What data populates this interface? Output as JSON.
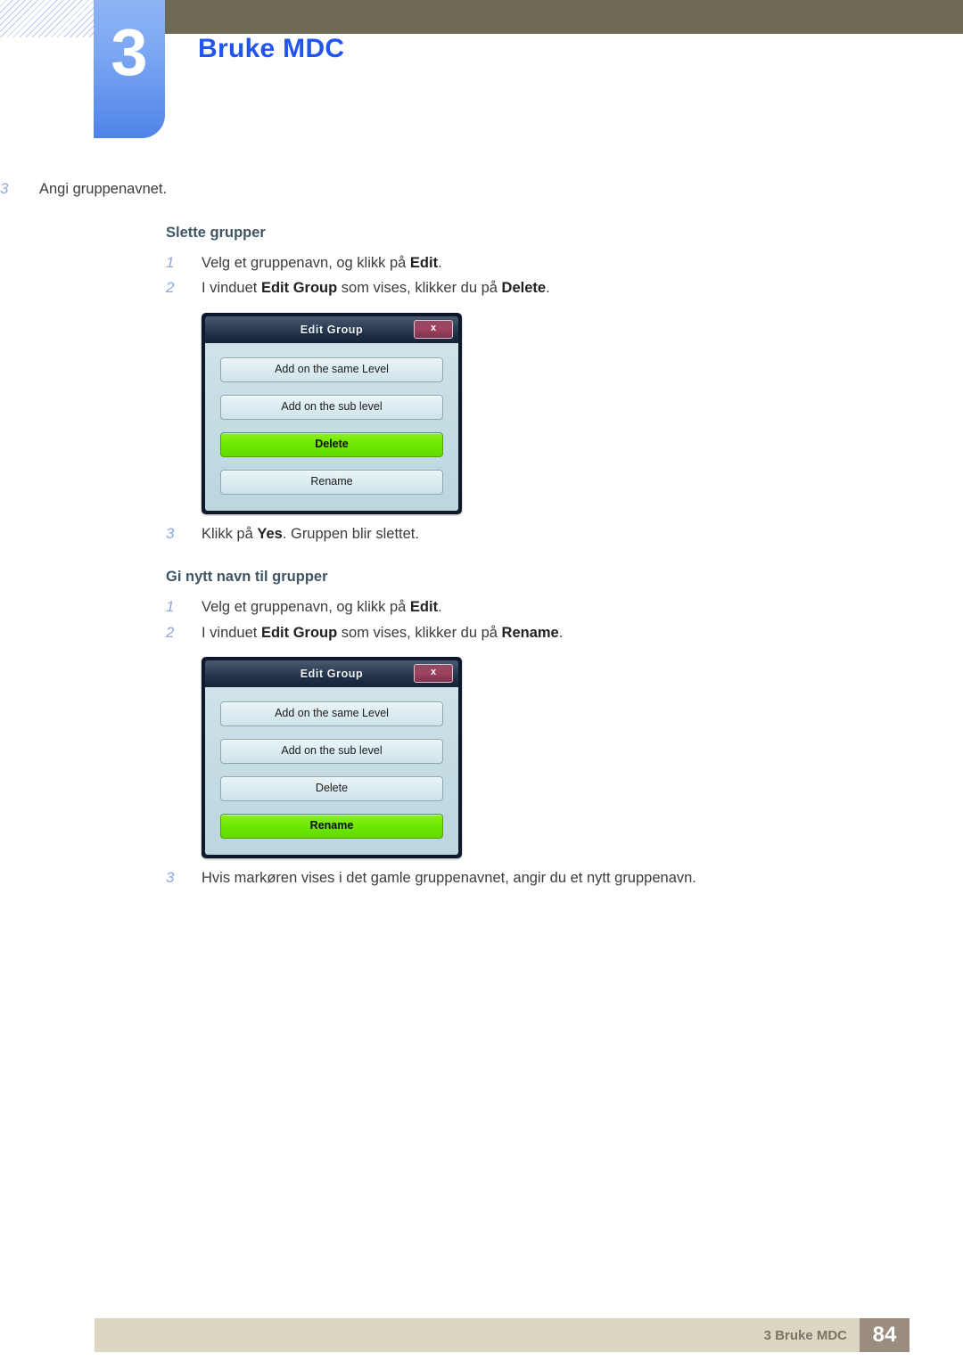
{
  "header": {
    "chapter_number": "3",
    "chapter_title": "Bruke MDC",
    "bar_color": "#6e6a53",
    "badge_color": "#7aa6f2",
    "title_color": "#2255ee"
  },
  "content": {
    "intro_step": {
      "num": "3",
      "text": "Angi gruppenavnet."
    },
    "sections": [
      {
        "heading": "Slette grupper",
        "steps": [
          {
            "num": "1",
            "parts": [
              {
                "t": "Velg et gruppenavn, og klikk på ",
                "b": false
              },
              {
                "t": "Edit",
                "b": true
              },
              {
                "t": ".",
                "b": false
              }
            ]
          },
          {
            "num": "2",
            "parts": [
              {
                "t": "I vinduet ",
                "b": false
              },
              {
                "t": "Edit Group",
                "b": true
              },
              {
                "t": " som vises, klikker du på ",
                "b": false
              },
              {
                "t": "Delete",
                "b": true
              },
              {
                "t": ".",
                "b": false
              }
            ]
          }
        ],
        "final_step": {
          "num": "3",
          "parts": [
            {
              "t": "Klikk på ",
              "b": false
            },
            {
              "t": "Yes",
              "b": true
            },
            {
              "t": ". Gruppen blir slettet.",
              "b": false
            }
          ]
        }
      },
      {
        "heading": "Gi nytt navn til grupper",
        "steps": [
          {
            "num": "1",
            "parts": [
              {
                "t": "Velg et gruppenavn, og klikk på ",
                "b": false
              },
              {
                "t": "Edit",
                "b": true
              },
              {
                "t": ".",
                "b": false
              }
            ]
          },
          {
            "num": "2",
            "parts": [
              {
                "t": "I vinduet ",
                "b": false
              },
              {
                "t": "Edit Group",
                "b": true
              },
              {
                "t": " som vises, klikker du på ",
                "b": false
              },
              {
                "t": "Rename",
                "b": true
              },
              {
                "t": ".",
                "b": false
              }
            ]
          }
        ],
        "final_step": {
          "num": "3",
          "parts": [
            {
              "t": "Hvis markøren vises i det gamle gruppenavnet, angir du et nytt gruppenavn.",
              "b": false
            }
          ]
        }
      }
    ]
  },
  "dialogs": [
    {
      "title": "Edit Group",
      "close_label": "x",
      "close_icon": "close-icon",
      "highlight_color": "#6fe800",
      "buttons": [
        {
          "label": "Add on the same Level",
          "highlighted": false
        },
        {
          "label": "Add on the sub level",
          "highlighted": false
        },
        {
          "label": "Delete",
          "highlighted": true
        },
        {
          "label": "Rename",
          "highlighted": false
        }
      ]
    },
    {
      "title": "Edit Group",
      "close_label": "x",
      "close_icon": "close-icon",
      "highlight_color": "#6fe800",
      "buttons": [
        {
          "label": "Add on the same Level",
          "highlighted": false
        },
        {
          "label": "Add on the sub level",
          "highlighted": false
        },
        {
          "label": "Delete",
          "highlighted": false
        },
        {
          "label": "Rename",
          "highlighted": true
        }
      ]
    }
  ],
  "footer": {
    "label": "3 Bruke MDC",
    "page_number": "84",
    "bar_color": "#dcd6c2",
    "page_box_color": "#9a8d7f"
  }
}
